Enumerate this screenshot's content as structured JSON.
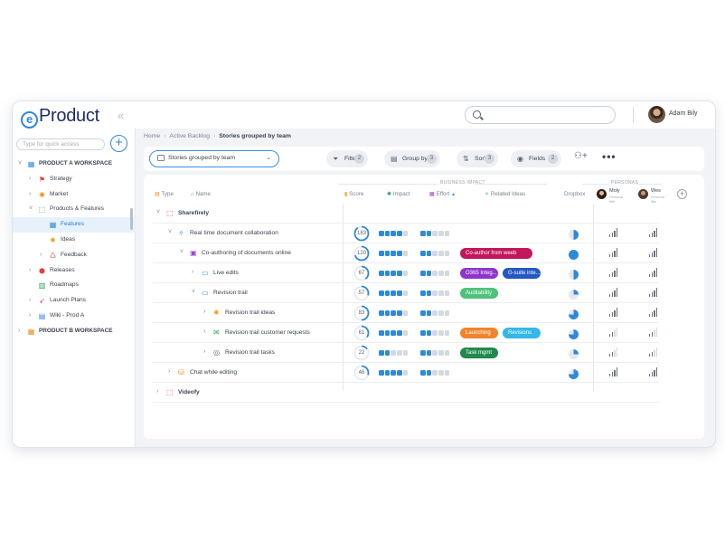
{
  "app": {
    "logo_letter": "e",
    "logo_text": "Product",
    "user_name": "Adam Bily",
    "search_placeholder": ""
  },
  "sidebar": {
    "quick_access_placeholder": "Type for quick access",
    "items": [
      {
        "label": "PRODUCT A WORKSPACE",
        "level": 0,
        "caret": "˅",
        "icon": "▦",
        "icon_color": "#2f89d9",
        "bold": true
      },
      {
        "label": "Strategy",
        "level": 1,
        "caret": "›",
        "icon": "⚑",
        "icon_color": "#e0413c"
      },
      {
        "label": "Market",
        "level": 1,
        "caret": "›",
        "icon": "✺",
        "icon_color": "#f08c1e"
      },
      {
        "label": "Products & Features",
        "level": 1,
        "caret": "˅",
        "icon": "⬚",
        "icon_color": "#27a148"
      },
      {
        "label": "Features",
        "level": 2,
        "caret": "",
        "icon": "▦",
        "icon_color": "#2f89d9",
        "selected": true
      },
      {
        "label": "Ideas",
        "level": 2,
        "caret": "",
        "icon": "✹",
        "icon_color": "#f0a81e"
      },
      {
        "label": "Feedback",
        "level": 2,
        "caret": "›",
        "icon": "♺",
        "icon_color": "#e0413c"
      },
      {
        "label": "Releases",
        "level": 1,
        "caret": "›",
        "icon": "⬢",
        "icon_color": "#e0413c"
      },
      {
        "label": "Roadmaps",
        "level": 1,
        "caret": "",
        "icon": "▥",
        "icon_color": "#27a148"
      },
      {
        "label": "Launch Plans",
        "level": 1,
        "caret": "›",
        "icon": "➶",
        "icon_color": "#d6336c"
      },
      {
        "label": "Wiki - Prod A",
        "level": 1,
        "caret": "›",
        "icon": "▤",
        "icon_color": "#2f89d9"
      },
      {
        "label": "PRODUCT B WORKSPACE",
        "level": 0,
        "caret": "›",
        "icon": "▦",
        "icon_color": "#f08c1e",
        "bold": true
      }
    ]
  },
  "breadcrumb": [
    "Home",
    "Active Backlog",
    "Stories grouped by team"
  ],
  "toolbar": {
    "view_label": "Stories grouped by team",
    "filter_label": "Filter",
    "filter_count": "2",
    "group_label": "Group by",
    "group_count": "3",
    "sort_label": "Sort",
    "sort_count": "3",
    "fields_label": "Fields",
    "fields_count": "2"
  },
  "columns": {
    "type": "Type",
    "name": "Name",
    "score": "Score",
    "impact": "Impact",
    "effort": "Effort",
    "related": "Related Ideas",
    "dropbox": "Dropbox",
    "business_impact": "BUSINESS IMPACT",
    "personas": "PERSONAS",
    "persona1_name": "Moly",
    "persona1_sub": "Persona title",
    "persona2_name": "Wes",
    "persona2_sub": "Persona title"
  },
  "colors": {
    "accent": "#2f89d9",
    "dot_on": "#2f89d9",
    "dot_off": "#d4d8e0"
  },
  "rows": [
    {
      "kind": "group",
      "label": "Sharefirely",
      "caret": "˅",
      "indent": 0,
      "icon": "⬚",
      "icon_color": "#e0413c"
    },
    {
      "label": "Real time document collaboration",
      "caret": "˅",
      "indent": 1,
      "icon": "✧",
      "icon_color": "#2f89d9",
      "score": 183,
      "score_frac": 0.9,
      "impact": 4,
      "effort": 2,
      "tags": [],
      "dropbox": 0.5,
      "p1": [
        3,
        3,
        3,
        3
      ],
      "p2": [
        3,
        3,
        3,
        3
      ]
    },
    {
      "label": "Co-authoring of documents online",
      "caret": "˅",
      "indent": 2,
      "icon": "▣",
      "icon_color": "#9b3fd1",
      "score": 120,
      "score_frac": 0.7,
      "impact": 4,
      "effort": 2,
      "tags": [
        {
          "label": "Co-author from weeb",
          "color": "#c2185b",
          "w": 80
        }
      ],
      "dropbox": 1,
      "p1": [
        3,
        3,
        3,
        3
      ],
      "p2": [
        3,
        3,
        3,
        3
      ]
    },
    {
      "label": "Live edits",
      "caret": "›",
      "indent": 3,
      "icon": "▭",
      "icon_color": "#2f89d9",
      "score": 67,
      "score_frac": 0.4,
      "impact": 4,
      "effort": 2,
      "tags": [
        {
          "label": "O365 Integ...",
          "color": "#8e36c9",
          "w": 42
        },
        {
          "label": "G-suite inte...",
          "color": "#2458c2",
          "w": 42
        }
      ],
      "dropbox": 0.5,
      "p1": [
        3,
        3,
        3,
        3
      ],
      "p2": [
        3,
        3,
        3,
        3
      ]
    },
    {
      "label": "Revision trail",
      "caret": "˅",
      "indent": 3,
      "icon": "▭",
      "icon_color": "#2f89d9",
      "score": 57,
      "score_frac": 0.3,
      "impact": 4,
      "effort": 2,
      "tags": [
        {
          "label": "Auditability",
          "color": "#4fc27a",
          "w": 42
        }
      ],
      "dropbox": 0.25,
      "p1": [
        3,
        3,
        3,
        3
      ],
      "p2": [
        3,
        3,
        3,
        3
      ]
    },
    {
      "label": "Revision trail ideas",
      "caret": "›",
      "indent": 4,
      "icon": "✹",
      "icon_color": "#f0a81e",
      "score": 83,
      "score_frac": 0.5,
      "impact": 4,
      "effort": 2,
      "tags": [],
      "dropbox": 0.75,
      "p1": [
        3,
        3,
        3,
        3
      ],
      "p2": [
        3,
        3,
        3,
        3
      ]
    },
    {
      "label": "Revision trail customer requests",
      "caret": "›",
      "indent": 4,
      "icon": "✉",
      "icon_color": "#27a148",
      "score": 61,
      "score_frac": 0.35,
      "impact": 4,
      "effort": 2,
      "tags": [
        {
          "label": "Launching",
          "color": "#f0842d",
          "w": 42
        },
        {
          "label": "Revisions",
          "color": "#35b7e8",
          "w": 42
        }
      ],
      "dropbox": 0.75,
      "p1": [
        1,
        1,
        0,
        0
      ],
      "p2": [
        1,
        1,
        0,
        0
      ]
    },
    {
      "label": "Revision trail tasks",
      "caret": "›",
      "indent": 4,
      "icon": "◎",
      "icon_color": "#5b6474",
      "score": 22,
      "score_frac": 0.15,
      "impact": 2,
      "effort": 2,
      "tags": [
        {
          "label": "Task mgmt",
          "color": "#1f8a4c",
          "w": 42
        }
      ],
      "dropbox": 0.25,
      "p1": [
        1,
        1,
        0,
        0
      ],
      "p2": [
        1,
        1,
        0,
        0
      ]
    },
    {
      "label": "Chat while editing",
      "caret": "›",
      "indent": 1,
      "icon": "⛁",
      "icon_color": "#f08c1e",
      "score": 46,
      "score_frac": 0.3,
      "impact": 4,
      "effort": 2,
      "tags": [],
      "dropbox": 0.75,
      "p1": [
        3,
        3,
        3,
        3
      ],
      "p2": [
        3,
        3,
        3,
        3
      ]
    },
    {
      "kind": "group",
      "label": "Videofy",
      "caret": "›",
      "indent": 0,
      "icon": "⬚",
      "icon_color": "#e0413c"
    }
  ]
}
